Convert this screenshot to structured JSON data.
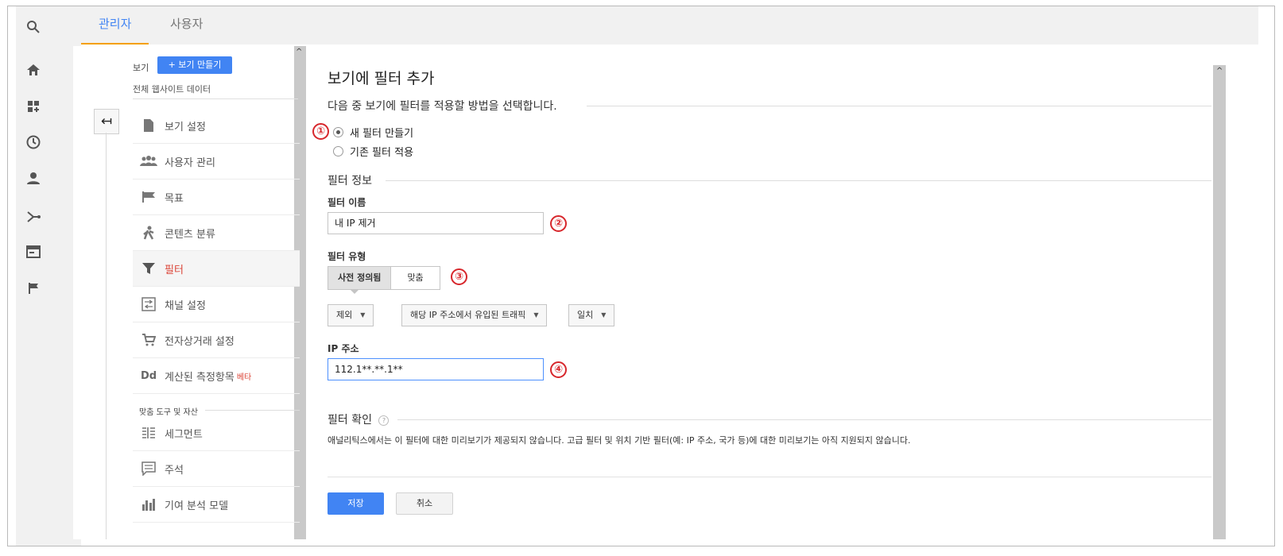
{
  "tabs": [
    {
      "label": "관리자",
      "active": true
    },
    {
      "label": "사용자",
      "active": false
    }
  ],
  "rail_icons": [
    "search-icon",
    "home-icon",
    "dashboard-add-icon",
    "clock-icon",
    "person-icon",
    "branch-icon",
    "browser-window-icon",
    "flag-icon"
  ],
  "nav": {
    "view_label": "보기",
    "create_view_label": "+ 보기 만들기",
    "view_name": "전체 웹사이트 데이터",
    "items": [
      {
        "label": "보기 설정",
        "icon": "document-icon"
      },
      {
        "label": "사용자 관리",
        "icon": "people-icon"
      },
      {
        "label": "목표",
        "icon": "flag-icon"
      },
      {
        "label": "콘텐츠 분류",
        "icon": "walking-person-icon"
      },
      {
        "label": "필터",
        "icon": "filter-icon",
        "active": true
      },
      {
        "label": "채널 설정",
        "icon": "channel-settings-icon"
      },
      {
        "label": "전자상거래 설정",
        "icon": "cart-icon"
      },
      {
        "label": "계산된 측정항목",
        "icon": "dd-icon",
        "badge": "베타"
      }
    ],
    "section_caption": "맞춤 도구 및 자산",
    "tool_items": [
      {
        "label": "세그먼트",
        "icon": "segment-icon"
      },
      {
        "label": "주석",
        "icon": "annotation-icon"
      },
      {
        "label": "기여 분석 모델",
        "icon": "bar-chart-icon"
      }
    ]
  },
  "main": {
    "title": "보기에 필터 추가",
    "subtitle": "다음 중 보기에 필터를 적용할 방법을 선택합니다.",
    "radio_options": [
      {
        "label": "새 필터 만들기",
        "checked": true
      },
      {
        "label": "기존 필터 적용",
        "checked": false
      }
    ],
    "filter_info_heading": "필터 정보",
    "filter_name_label": "필터 이름",
    "filter_name_value": "내 IP 제거",
    "filter_type_label": "필터 유형",
    "filter_type_options": [
      "사전 정의됨",
      "맞춤"
    ],
    "dropdowns": [
      "제외",
      "해당 IP 주소에서 유입된 트래픽",
      "일치"
    ],
    "ip_label": "IP 주소",
    "ip_value": "112.1**.**.1**",
    "verify_heading": "필터 확인",
    "help_icon": "?",
    "notice": "애널리틱스에서는 이 필터에 대한 미리보기가 제공되지 않습니다. 고급 필터 및 위치 기반 필터(예: IP 주소, 국가 등)에 대한 미리보기는 아직 지원되지 않습니다.",
    "save_label": "저장",
    "cancel_label": "취소"
  },
  "annotations": [
    "①",
    "②",
    "③",
    "④"
  ],
  "colors": {
    "accent": "#4184f3",
    "tab_underline": "#f4a000",
    "annotation_red": "#d7262b",
    "active_nav_text": "#db4437"
  }
}
